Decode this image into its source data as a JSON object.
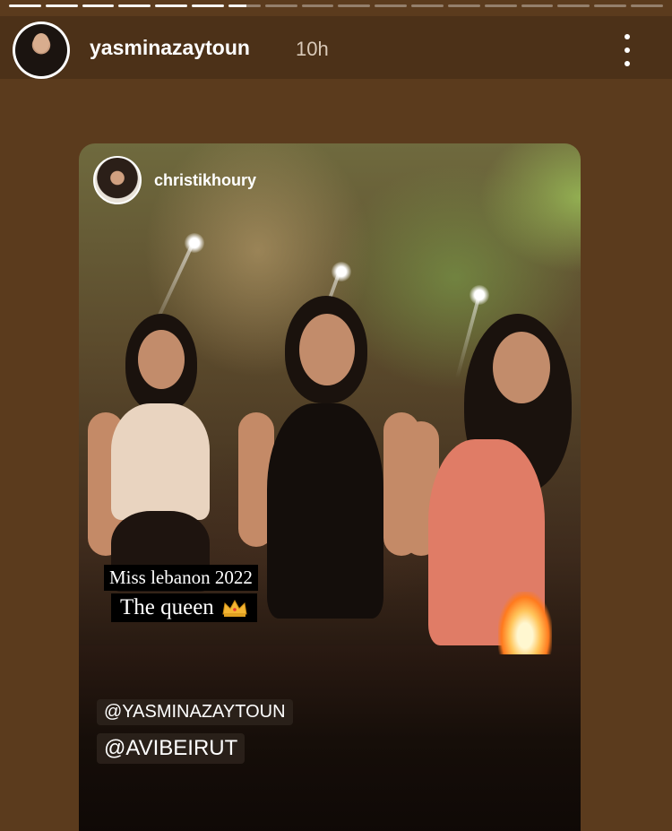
{
  "story": {
    "segments_total": 18,
    "segments_done": 6,
    "username": "yasminazaytoun",
    "timestamp": "10h"
  },
  "card": {
    "source_username": "christikhoury",
    "caption_line1": "Miss lebanon 2022",
    "caption_line2": "The  queen",
    "tag1": "@YASMINAZAYTOUN",
    "tag2": "@AVIBEIRUT"
  },
  "icons": {
    "more": "more-vertical-icon",
    "crown": "crown-icon"
  },
  "colors": {
    "background": "#5b3b1d",
    "header": "#4c3118"
  }
}
